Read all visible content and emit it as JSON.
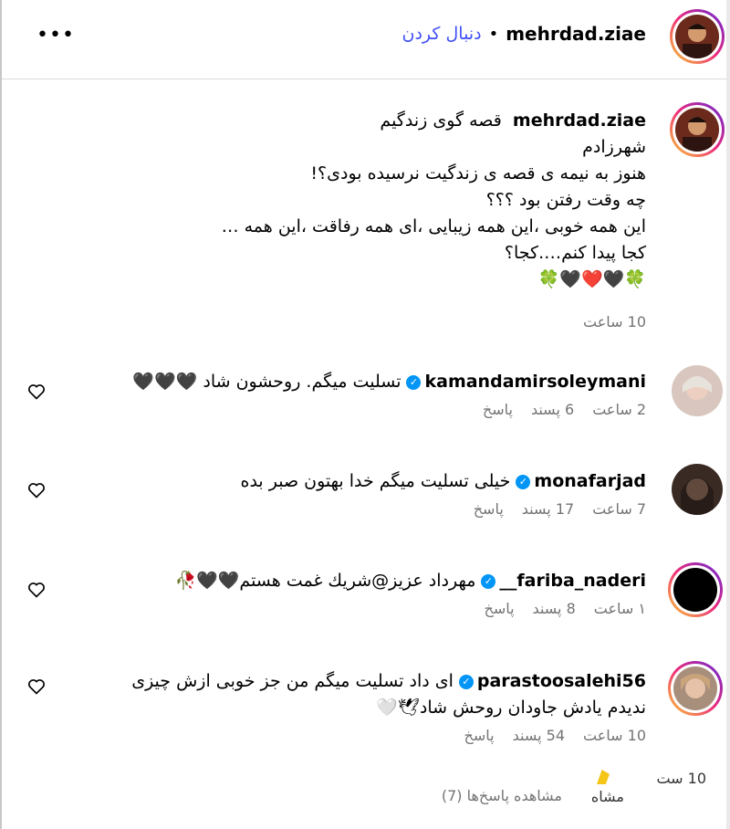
{
  "header": {
    "username": "mehrdad.ziae",
    "separator": "•",
    "follow_label": "دنبال کردن",
    "more_icon": "•••"
  },
  "caption": {
    "username": "mehrdad.ziae",
    "lines": [
      "قصه گوی زندگیم",
      "شهرزادم",
      "هنوز به نیمه ی قصه ی زندگیت نرسیده بودی؟!",
      "چه وقت رفتن بود ؟؟؟",
      "این همه خوبی ،این همه زیبایی ،ای همه رفاقت ،این همه …",
      "کجا پیدا کنم….کجا؟",
      "🍀🖤❤️🖤🍀"
    ],
    "time": "10 ساعت"
  },
  "comments": [
    {
      "username": "kamandamirsoleymani",
      "text": "تسلیت میگم. روحشون شاد 🖤🖤🖤",
      "time": "2 ساعت",
      "likes": "6 پسند",
      "reply": "پاسخ"
    },
    {
      "username": "monafarjad",
      "text": "خیلی تسلیت میگم خدا بهتون صبر بده",
      "time": "7 ساعت",
      "likes": "17 پسند",
      "reply": "پاسخ"
    },
    {
      "username": "fariba_naderi__",
      "text": "مهرداد عزیز@شریك غمت هستم🖤🖤🥀",
      "time": "۱ ساعت",
      "likes": "8 پسند",
      "reply": "پاسخ"
    },
    {
      "username": "parastoosalehi56",
      "text": "ای داد تسلیت میگم من جز خوبی ازش چیزی ندیدم یادش جاودان روحش شاد🕊🤍",
      "time": "10 ساعت",
      "likes": "54 پسند",
      "reply": "پاسخ"
    }
  ],
  "view_replies": "مشاهده پاسخ‌ها (7)",
  "overlay_fragment": {
    "line1": "10 ست",
    "line2": "مشاه"
  },
  "icons": {
    "verified": "verified-badge-icon",
    "like": "heart-outline-icon",
    "more": "more-options-icon"
  },
  "colors": {
    "follow": "#4150f7",
    "verified": "#0095f6",
    "meta": "#737373"
  }
}
